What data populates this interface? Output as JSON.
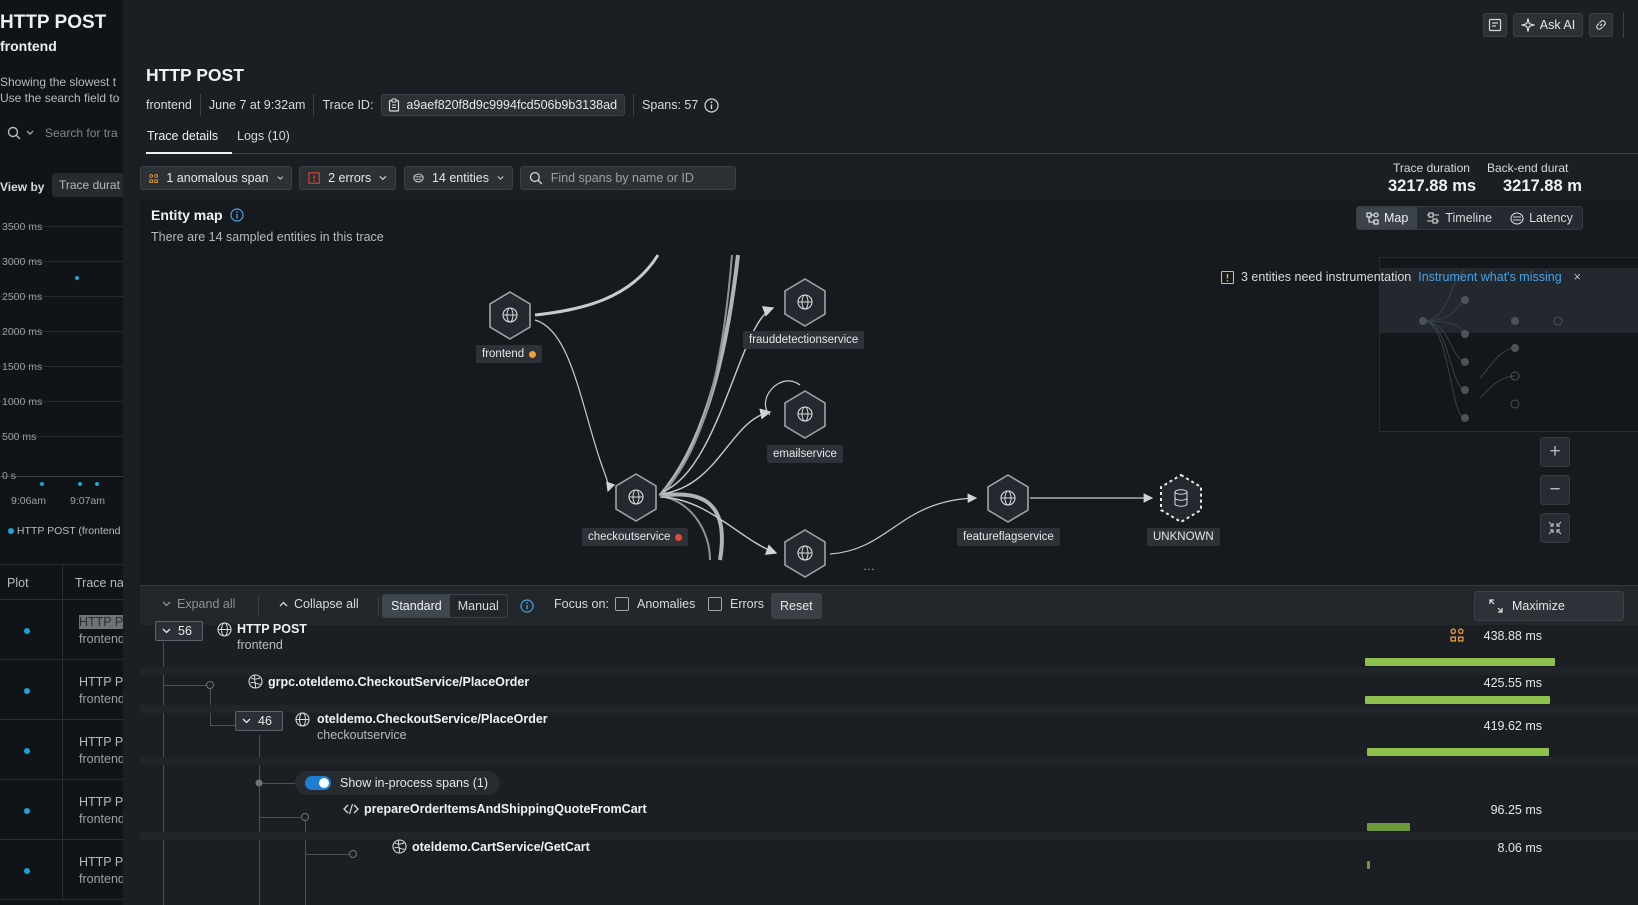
{
  "left_panel": {
    "title": "HTTP POST",
    "subtitle": "frontend",
    "desc_line1": "Showing the slowest t",
    "desc_line2": "Use the search field to",
    "search_placeholder": "Search for tra",
    "view_by_label": "View by",
    "view_by_value": "Trace durat",
    "chart": {
      "y_ticks": [
        "3500 ms",
        "3000 ms",
        "2500 ms",
        "2000 ms",
        "1500 ms",
        "1000 ms",
        "500 ms",
        "0 s"
      ],
      "x_ticks": [
        "9:06am",
        "9:07am"
      ],
      "legend": "HTTP POST (frontend"
    },
    "table": {
      "col_plot": "Plot",
      "col_name": "Trace na",
      "rows": [
        {
          "name": "HTTP P",
          "service": "frontend"
        },
        {
          "name": "HTTP P",
          "service": "frontend"
        },
        {
          "name": "HTTP P",
          "service": "frontend"
        },
        {
          "name": "HTTP P",
          "service": "frontend"
        },
        {
          "name": "HTTP P",
          "service": "frontend"
        }
      ]
    }
  },
  "toolbar": {
    "ask_ai": "Ask AI"
  },
  "header": {
    "title": "HTTP POST",
    "service": "frontend",
    "date": "June 7 at 9:32am",
    "trace_id_label": "Trace ID:",
    "trace_id": "a9aef820f8d9c9994fcd506b9b3138ad",
    "spans": "Spans: 57"
  },
  "tabs": [
    {
      "label": "Trace details"
    },
    {
      "label": "Logs (10)"
    }
  ],
  "filters": {
    "anomalous": "1 anomalous span",
    "errors": "2 errors",
    "entities": "14 entities",
    "search_placeholder": "Find spans by name or ID"
  },
  "durations": {
    "trace_label": "Trace duration",
    "trace_value": "3217.88 ms",
    "backend_label": "Back-end durat",
    "backend_value": "3217.88 m"
  },
  "entity_map": {
    "title": "Entity map",
    "subtitle": "There are 14 sampled entities in this trace",
    "views": [
      "Map",
      "Timeline",
      "Latency"
    ],
    "instrumentation_notice": "3 entities need instrumentation",
    "instrumentation_link": "Instrument what's missing",
    "nodes": {
      "frontend": "frontend",
      "frauddetection": "frauddetectionservice",
      "email": "emailservice",
      "checkout": "checkoutservice",
      "featureflag": "featureflagservice",
      "unknown": "UNKNOWN"
    },
    "status_colors": {
      "warning": "#f0a03a",
      "error": "#e8443a"
    }
  },
  "span_toolbar": {
    "expand_all": "Expand all",
    "collapse_all": "Collapse all",
    "mode_standard": "Standard",
    "mode_manual": "Manual",
    "focus_on": "Focus on:",
    "anomalies": "Anomalies",
    "errors": "Errors",
    "reset": "Reset",
    "maximize": "Maximize"
  },
  "spans": [
    {
      "count": "56",
      "name": "HTTP POST",
      "service": "frontend",
      "duration": "438.88 ms",
      "bar_fraction": 0.71
    },
    {
      "name": "grpc.oteldemo.CheckoutService/PlaceOrder",
      "duration": "425.55 ms",
      "bar_fraction": 0.69
    },
    {
      "count": "46",
      "name": "oteldemo.CheckoutService/PlaceOrder",
      "service": "checkoutservice",
      "duration": "419.62 ms",
      "bar_fraction": 0.68
    },
    {
      "toggle_label": "Show in-process spans (1)"
    },
    {
      "name": "prepareOrderItemsAndShippingQuoteFromCart",
      "duration": "96.25 ms",
      "bar_fraction": 0.16
    },
    {
      "name": "oteldemo.CartService/GetCart",
      "duration": "8.06 ms",
      "bar_fraction": 0.01
    }
  ]
}
